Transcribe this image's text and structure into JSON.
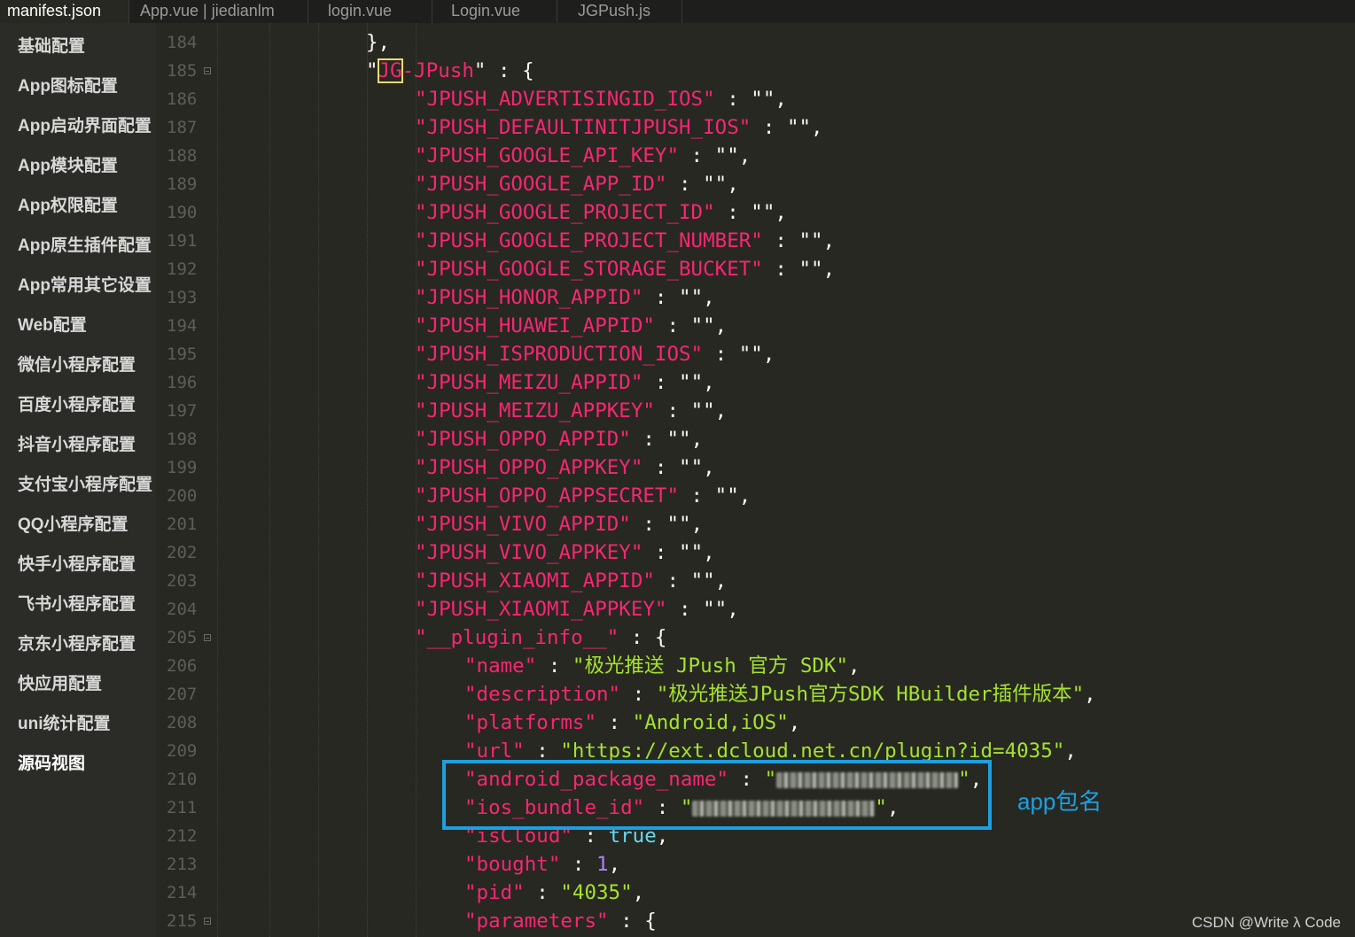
{
  "tabs": [
    {
      "label": "manifest.json",
      "active": true
    },
    {
      "label": "App.vue | jiedianlm",
      "active": false
    },
    {
      "label": "login.vue",
      "active": false
    },
    {
      "label": "Login.vue",
      "active": false
    },
    {
      "label": "JGPush.js",
      "active": false
    }
  ],
  "sidebar": {
    "items": [
      "基础配置",
      "App图标配置",
      "App启动界面配置",
      "App模块配置",
      "App权限配置",
      "App原生插件配置",
      "App常用其它设置",
      "Web配置",
      "微信小程序配置",
      "百度小程序配置",
      "抖音小程序配置",
      "支付宝小程序配置",
      "QQ小程序配置",
      "快手小程序配置",
      "飞书小程序配置",
      "京东小程序配置",
      "快应用配置",
      "uni统计配置",
      "源码视图"
    ],
    "active_index": 18
  },
  "editor": {
    "line_numbers": [
      "184",
      "185",
      "186",
      "187",
      "188",
      "189",
      "190",
      "191",
      "192",
      "193",
      "194",
      "195",
      "196",
      "197",
      "198",
      "199",
      "200",
      "201",
      "202",
      "203",
      "204",
      "205",
      "206",
      "207",
      "208",
      "209",
      "210",
      "211",
      "212",
      "213",
      "214",
      "215"
    ],
    "fold_markers": [
      "185",
      "205",
      "215"
    ],
    "lines": [
      "},",
      "\"JG-JPush\" : {",
      "\"JPUSH_ADVERTISINGID_IOS\" : \"\",",
      "\"JPUSH_DEFAULTINITJPUSH_IOS\" : \"\",",
      "\"JPUSH_GOOGLE_API_KEY\" : \"\",",
      "\"JPUSH_GOOGLE_APP_ID\" : \"\",",
      "\"JPUSH_GOOGLE_PROJECT_ID\" : \"\",",
      "\"JPUSH_GOOGLE_PROJECT_NUMBER\" : \"\",",
      "\"JPUSH_GOOGLE_STORAGE_BUCKET\" : \"\",",
      "\"JPUSH_HONOR_APPID\" : \"\",",
      "\"JPUSH_HUAWEI_APPID\" : \"\",",
      "\"JPUSH_ISPRODUCTION_IOS\" : \"\",",
      "\"JPUSH_MEIZU_APPID\" : \"\",",
      "\"JPUSH_MEIZU_APPKEY\" : \"\",",
      "\"JPUSH_OPPO_APPID\" : \"\",",
      "\"JPUSH_OPPO_APPKEY\" : \"\",",
      "\"JPUSH_OPPO_APPSECRET\" : \"\",",
      "\"JPUSH_VIVO_APPID\" : \"\",",
      "\"JPUSH_VIVO_APPKEY\" : \"\",",
      "\"JPUSH_XIAOMI_APPID\" : \"\",",
      "\"JPUSH_XIAOMI_APPKEY\" : \"\",",
      "\"__plugin_info__\" : {",
      "\"name\" : \"极光推送 JPush 官方 SDK\",",
      "\"description\" : \"极光推送JPush官方SDK HBuilder插件版本\",",
      "\"platforms\" : \"Android,iOS\",",
      "\"url\" : \"https://ext.dcloud.net.cn/plugin?id=4035\",",
      "\"android_package_name\" : \"[redacted]\",",
      "\"ios_bundle_id\" : \"[redacted]\",",
      "\"isCloud\" : true,",
      "\"bought\" : 1,",
      "\"pid\" : \"4035\",",
      "\"parameters\" : {"
    ]
  },
  "annotation": {
    "label": "app包名",
    "color": "#1e9fe0"
  },
  "watermark": "CSDN @Write λ Code",
  "colors": {
    "background": "#272822",
    "sidebar": "#2b2c27",
    "key": "#f92672",
    "string": "#a6e22e",
    "number": "#ae81ff",
    "boolean": "#66d9ef",
    "highlight": "#e6db74"
  }
}
